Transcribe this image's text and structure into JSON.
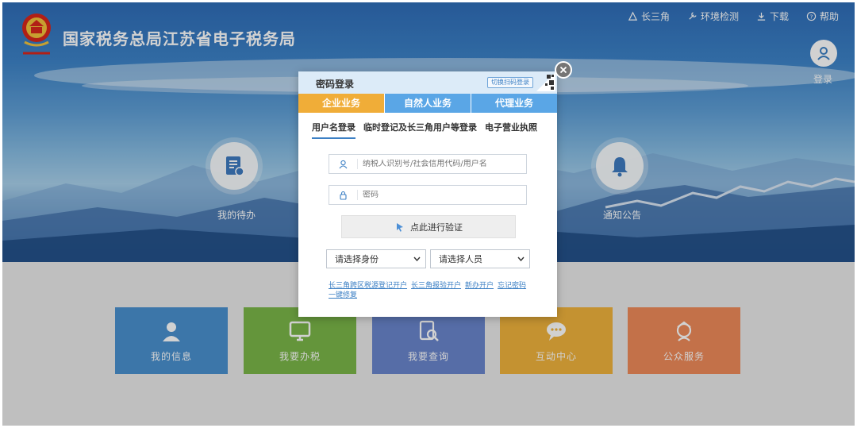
{
  "site": {
    "title": "国家税务总局江苏省电子税务局"
  },
  "topnav": [
    {
      "label": "长三角",
      "icon": "delta-icon"
    },
    {
      "label": "环境检测",
      "icon": "wrench-icon"
    },
    {
      "label": "下载",
      "icon": "download-icon"
    },
    {
      "label": "帮助",
      "icon": "help-icon"
    }
  ],
  "login": {
    "label": "登录"
  },
  "hero": {
    "left_label": "我的待办",
    "right_label": "通知公告"
  },
  "tiles": [
    {
      "label": "我的信息",
      "color": "#4a90cf",
      "icon": "user-icon"
    },
    {
      "label": "我要办税",
      "color": "#7ab648",
      "icon": "monitor-icon"
    },
    {
      "label": "我要查询",
      "color": "#6a86cc",
      "icon": "search-doc-icon"
    },
    {
      "label": "互动中心",
      "color": "#f0b23c",
      "icon": "chat-icon"
    },
    {
      "label": "公众服务",
      "color": "#ee8a5a",
      "icon": "service-icon"
    }
  ],
  "modal": {
    "title": "密码登录",
    "switch_label": "切换扫码登录",
    "biz_tabs": [
      "企业业务",
      "自然人业务",
      "代理业务"
    ],
    "sub_tabs": [
      "用户名登录",
      "临时登记及长三角用户等登录",
      "电子营业执照"
    ],
    "username_placeholder": "纳税人识别号/社会信用代码/用户名",
    "password_placeholder": "密码",
    "verify_label": "点此进行验证",
    "identity_select": "请选择身份",
    "person_select": "请选择人员",
    "links": [
      "长三角跨区税源登记开户",
      "长三角报验开户",
      "新办开户",
      "忘记密码",
      "一键修复"
    ]
  },
  "colors": {
    "accent_orange": "#f0ad38",
    "accent_blue": "#5aa6e6",
    "link_blue": "#3b7fc4"
  }
}
